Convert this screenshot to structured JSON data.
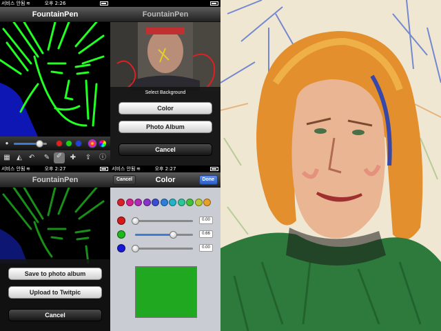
{
  "status_bars": [
    {
      "carrier": "서비스 안됨",
      "time": "오후 2:26"
    },
    {
      "carrier": "서비스 안됨",
      "time": "오후 2:27"
    }
  ],
  "app_title": "FountainPen",
  "toolbar": {
    "colors": [
      "#e0201a",
      "#1ad11a",
      "#2040e0",
      "#e04080"
    ],
    "brush_size": 0.8
  },
  "select_background": {
    "title": "Select Background",
    "color_label": "Color",
    "photo_album_label": "Photo Album",
    "cancel_label": "Cancel"
  },
  "save_sheet": {
    "save_label": "Save to photo album",
    "twitpic_label": "Upload to Twitpic",
    "cancel_label": "Cancel"
  },
  "color_picker": {
    "title": "Color",
    "cancel_label": "Cancel",
    "done_label": "Done",
    "palette": [
      "#d8202a",
      "#d2208c",
      "#b02ab8",
      "#8833c8",
      "#3a4fd0",
      "#2f7fd8",
      "#25b3c4",
      "#2bc59a",
      "#42c23c",
      "#b6c834",
      "#e8a028"
    ],
    "channels": [
      {
        "name": "red",
        "color": "#d81818",
        "value": 0.0,
        "label": "0.00"
      },
      {
        "name": "green",
        "color": "#1cb81c",
        "value": 0.66,
        "label": "0.66"
      },
      {
        "name": "blue",
        "color": "#1818d8",
        "value": 0.0,
        "label": "0.00"
      }
    ],
    "preview_color": "#20a820"
  }
}
